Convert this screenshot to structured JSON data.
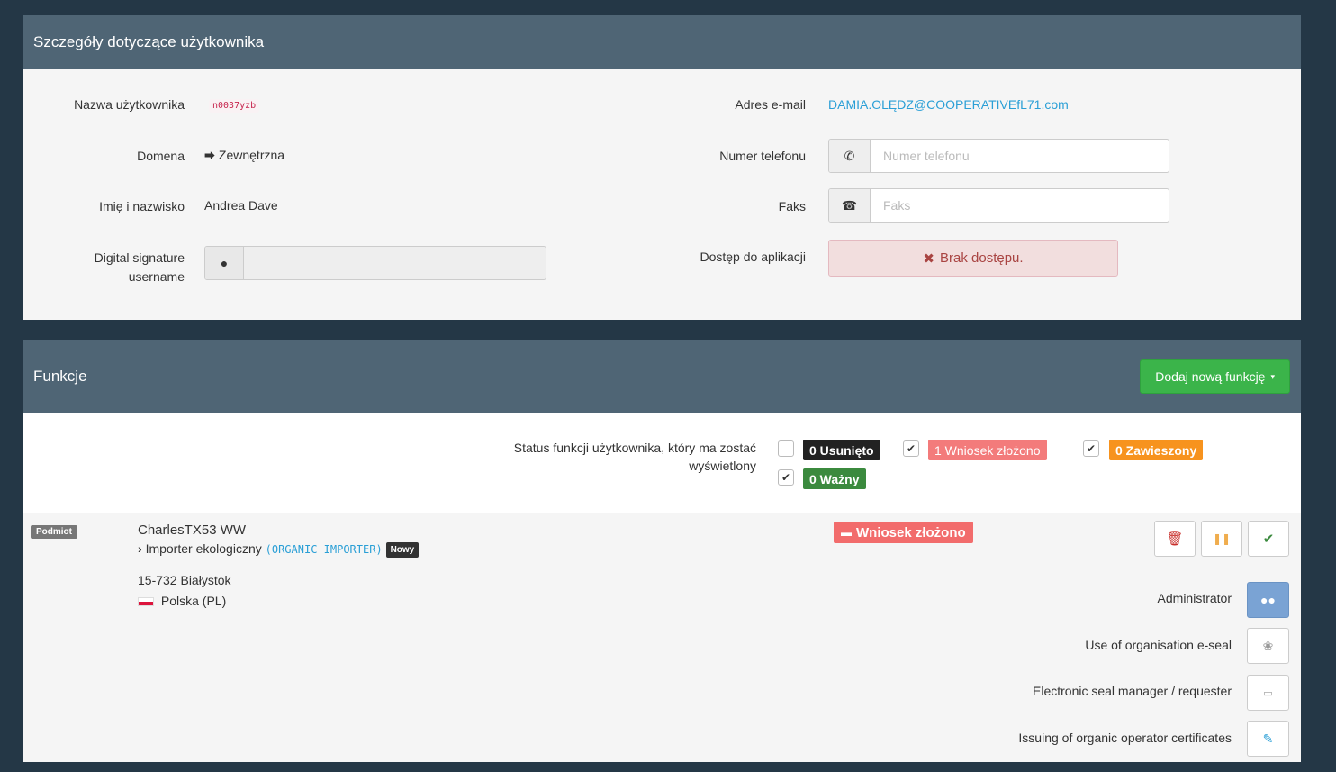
{
  "user_panel": {
    "title": "Szczegóły dotyczące użytkownika",
    "username_label": "Nazwa użytkownika",
    "username_value": "n0037yzb",
    "domain_label": "Domena",
    "domain_icon": "sign-in-icon",
    "domain_value": "Zewnętrzna",
    "fullname_label": "Imię i nazwisko",
    "fullname_value": "Andrea Dave",
    "digsig_label_line1": "Digital signature",
    "digsig_label_line2": "username",
    "digsig_value": "",
    "email_label": "Adres e-mail",
    "email_value": "DAMIA.OLĘDZ@COOPERATIVEfL71.com",
    "phone_label": "Numer telefonu",
    "phone_placeholder": "Numer telefonu",
    "phone_value": "",
    "fax_label": "Faks",
    "fax_placeholder": "Faks",
    "fax_value": "",
    "access_label": "Dostęp do aplikacji",
    "access_value": "Brak dostępu."
  },
  "functions_panel": {
    "title": "Funkcje",
    "add_button": "Dodaj nową funkcję",
    "status_label": "Status funkcji użytkownika, który ma zostać wyświetlony",
    "statuses": [
      {
        "label": "0 Usunięto",
        "checked": false,
        "color": "#222222"
      },
      {
        "label": "1 Wniosek złożono",
        "checked": true,
        "color": "#f37b7b"
      },
      {
        "label": "0 Zawieszony",
        "checked": true,
        "color": "#f7931e"
      },
      {
        "label": "0 Ważny",
        "checked": true,
        "color": "#3b8a3e"
      }
    ],
    "entity": {
      "type_tag": "Podmiot",
      "name": "CharlesTX53 WW",
      "role_name": "Importer ekologiczny",
      "role_code": "(ORGANIC IMPORTER)",
      "new_badge": "Nowy",
      "address_line": "15-732 Białystok",
      "country": "Polska (PL)",
      "application_status": "Wniosek złożono",
      "roles": [
        {
          "label": "Administrator",
          "icon": "users-icon",
          "active": true
        },
        {
          "label": "Use of organisation e-seal",
          "icon": "certificate-icon",
          "active": false
        },
        {
          "label": "Electronic seal manager / requester",
          "icon": "id-card-icon",
          "active": false
        },
        {
          "label": "Issuing of organic operator certificates",
          "icon": "pencil-icon",
          "active": false
        }
      ]
    }
  },
  "colors": {
    "background": "#243746",
    "panel_header": "#4f6575",
    "success": "#3bb44a",
    "danger": "#f26c6c",
    "link": "#2a9fd6"
  }
}
